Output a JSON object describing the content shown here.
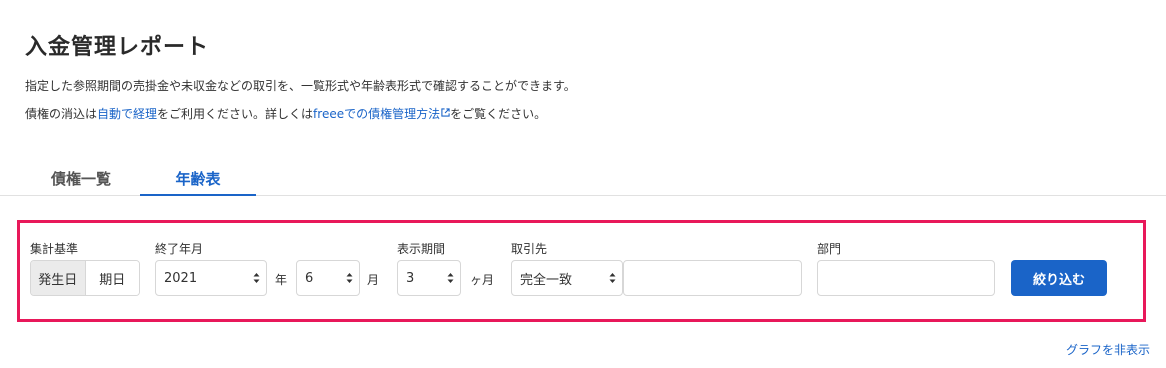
{
  "header": {
    "title": "入金管理レポート",
    "description": "指定した参照期間の売掛金や未収金などの取引を、一覧形式や年齢表形式で確認することができます。",
    "note_prefix": "債権の消込は",
    "note_link1": "自動で経理",
    "note_middle": "をご利用ください。詳しくは",
    "note_link2": "freeeでの債権管理方法",
    "note_link2_icon": "external-link-icon",
    "note_suffix": "をご覧ください。"
  },
  "tabs": [
    {
      "label": "債権一覧",
      "active": false
    },
    {
      "label": "年齢表",
      "active": true
    }
  ],
  "filter": {
    "basis": {
      "label": "集計基準",
      "options": [
        "発生日",
        "期日"
      ],
      "selected": "発生日"
    },
    "end_month": {
      "label": "終了年月",
      "year_value": "2021",
      "year_unit": "年",
      "month_value": "6",
      "month_unit": "月"
    },
    "period": {
      "label": "表示期間",
      "value": "3",
      "unit": "ヶ月"
    },
    "partner": {
      "label": "取引先",
      "match_value": "完全一致",
      "text_value": ""
    },
    "department": {
      "label": "部門",
      "text_value": ""
    },
    "submit_label": "絞り込む",
    "highlight_color": "#e8185a"
  },
  "graph_toggle_label": "グラフを非表示",
  "colors": {
    "accent": "#1a64c8",
    "text": "#323232"
  }
}
